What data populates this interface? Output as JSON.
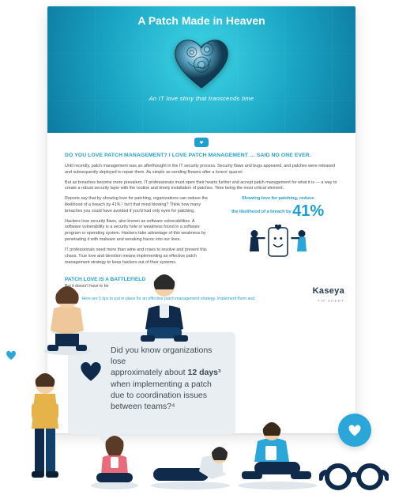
{
  "hero": {
    "title": "A Patch Made in Heaven",
    "subtitle": "An IT love story that transcends time"
  },
  "headline": "DO YOU LOVE PATCH MANAGEMENT? I LOVE PATCH MANAGEMENT … SAID NO ONE EVER.",
  "paras": {
    "p1": "Until recently, patch management was an afterthought in the IT security process. Security flaws and bugs appeared, and patches were released and subsequently deployed to repair them. As simple as sending flowers after a lovers' quarrel.",
    "p2": "But as breaches become more prevalent, IT professionals must open their hearts further and accept patch management for what it is — a way to create a robust security layer with the routine and timely installation of patches. Time being the most critical element.",
    "p3": "Reports say that by showing love for patching, organizations can reduce the likelihood of a breach by 41%.¹ Isn't that mind blowing? Think how many breaches you could have avoided if you'd had only eyes for patching.",
    "p4": "Hackers love security flaws, also known as software vulnerabilities. A software vulnerability is a security hole or weakness found in a software program or operating system. Hackers take advantage of this weakness by penetrating it with malware and wreaking havoc into our lives.",
    "p5": "IT professionals need more than wine and roses to resolve and prevent this chaos. True love and devotion means implementing an effective patch management strategy to keep hackers out of their systems."
  },
  "stat": {
    "title_line1": "Showing love for patching, reduce",
    "title_line2": "the likelihood of a breach by",
    "value": "41%"
  },
  "section2": {
    "head": "PATCH LOVE IS A BATTLEFIELD",
    "sub": "But it doesn't have to be",
    "tip": "Here are 5 tips to put in place for an effective patch management strategy. Implement them and"
  },
  "bubble": {
    "line1": "Did you know organizations lose",
    "line2_pre": "approximately about ",
    "line2_strong": "12 days³",
    "line3": "when implementing a patch",
    "line4": "due to coordination issues",
    "line5": "between teams?⁴"
  },
  "brand": {
    "name": "Kaseya",
    "sub": "TIP SHEET"
  },
  "colors": {
    "accent": "#1f9fcf",
    "navy": "#0f2a4a"
  }
}
